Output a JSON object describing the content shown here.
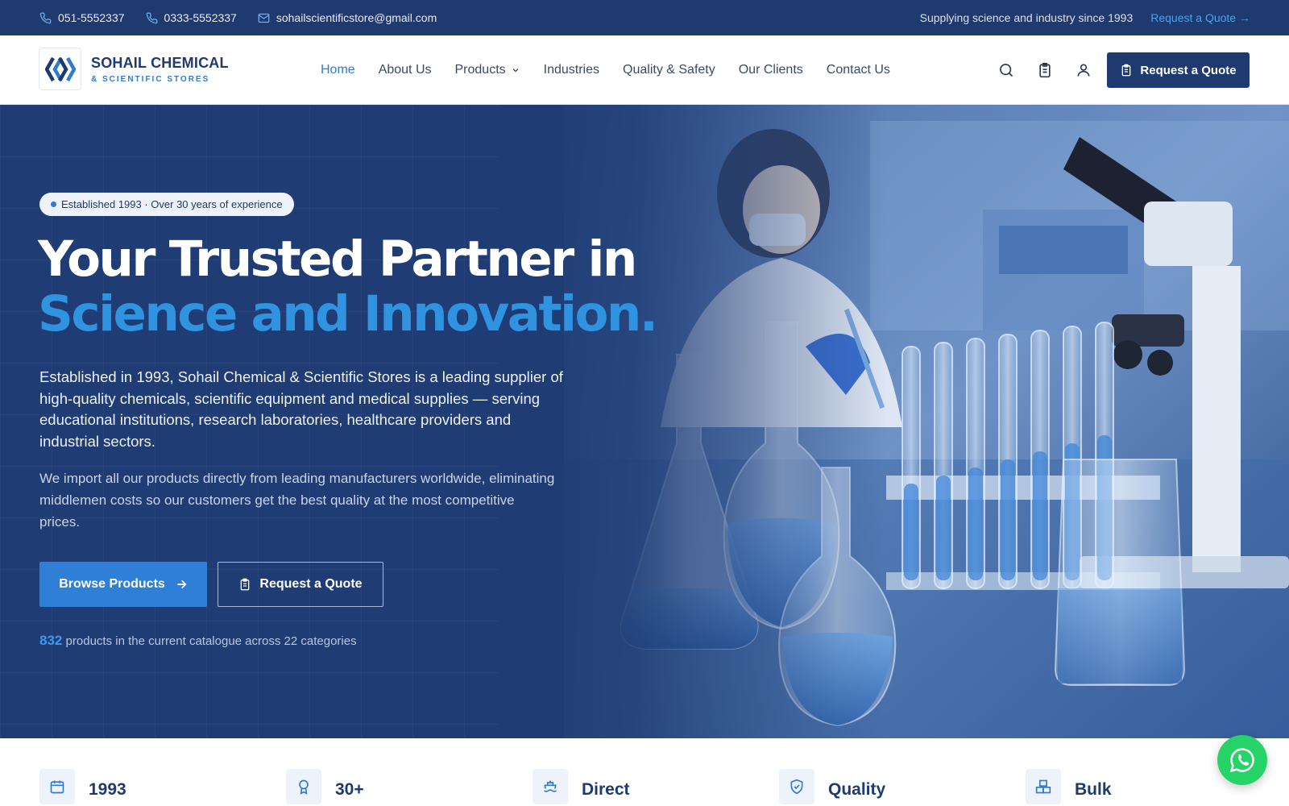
{
  "topbar": {
    "phone1": "051-5552337",
    "phone2": "0333-5552337",
    "email": "sohailscientificstore@gmail.com",
    "tagline": "Supplying science and industry since 1993",
    "quote_link": "Request a Quote →"
  },
  "header": {
    "logo_line1": "SOHAIL CHEMICAL",
    "logo_line2": "& SCIENTIFIC STORES",
    "nav": [
      "Home",
      "About Us",
      "Products",
      "Industries",
      "Quality & Safety",
      "Our Clients",
      "Contact Us"
    ],
    "cta": "Request a Quote"
  },
  "hero": {
    "badge": "Established 1993 · Over 30 years of experience",
    "title_line1": "Your Trusted Partner in",
    "title_line2": "Science and Innovation.",
    "paragraph1": "Established in 1993, Sohail Chemical & Scientific Stores is a leading supplier of high-quality chemicals, scientific equipment and medical supplies — serving educational institutions, research laboratories, healthcare providers and industrial sectors.",
    "paragraph2": "We import all our products directly from leading manufacturers worldwide, eliminating middlemen costs so our customers get the best quality at the most competitive prices.",
    "btn_primary": "Browse Products",
    "btn_secondary": "Request a Quote",
    "catalog_count": "832",
    "catalog_text": " products in the current catalogue across 22 categories"
  },
  "stats": [
    {
      "title": "1993",
      "icon": "calendar-icon"
    },
    {
      "title": "30+",
      "icon": "award-icon"
    },
    {
      "title": "Direct",
      "icon": "ship-icon"
    },
    {
      "title": "Quality",
      "icon": "shield-check-icon"
    },
    {
      "title": "Bulk",
      "icon": "boxes-icon"
    }
  ],
  "colors": {
    "navy": "#1e3a6e",
    "accent": "#2f7fd6",
    "accent_light": "#2f93e0",
    "whatsapp": "#25d366"
  }
}
